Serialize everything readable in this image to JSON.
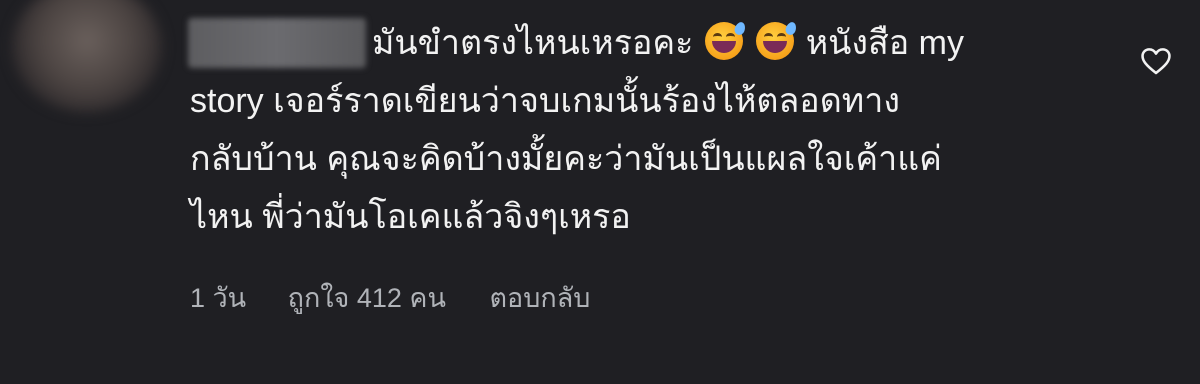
{
  "comment": {
    "text_line1_a": "มันขำตรงไหนเหรอคะ",
    "text_line1_b": "หนังสือ my",
    "text_line2": "story เจอร์ราดเขียนว่าจบเกมนั้นร้องไห้ตลอดทาง",
    "text_line3": "กลับบ้าน คุณจะคิดบ้างมั้ยคะว่ามันเป็นแผลใจเค้าแค่",
    "text_line4": "ไหน พี่ว่ามันโอเคแล้วจิงๆเหรอ",
    "emoji_name": "grinning-face-with-sweat",
    "emoji_count": 2
  },
  "actions": {
    "time": "1 วัน",
    "likes": "ถูกใจ 412 คน",
    "reply": "ตอบกลับ"
  },
  "icons": {
    "like": "heart-outline-icon"
  },
  "colors": {
    "background": "#1f1f23",
    "text": "#f2f2f2",
    "secondary_text": "#b0b3b8"
  }
}
